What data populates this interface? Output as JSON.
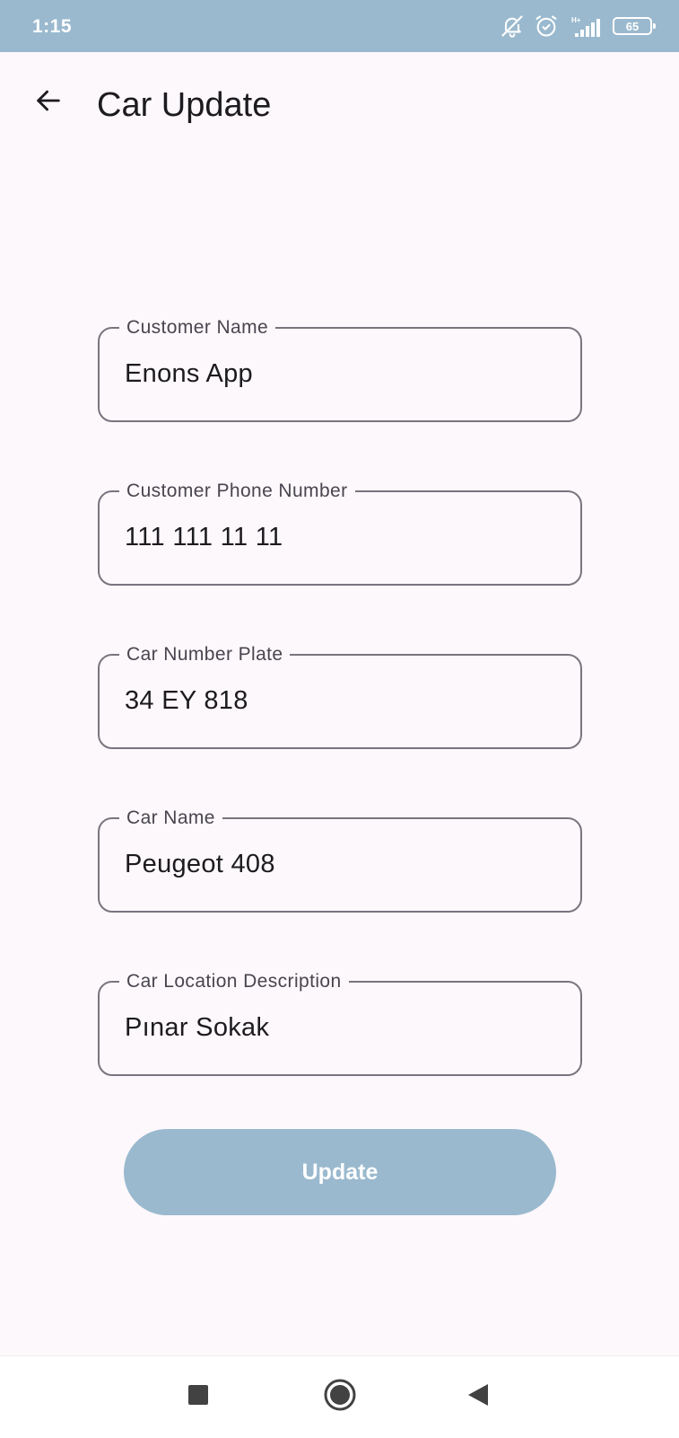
{
  "status_bar": {
    "time": "1:15",
    "battery_level": "65"
  },
  "app_bar": {
    "title": "Car Update"
  },
  "form": {
    "customer_name": {
      "label": "Customer Name",
      "value": "Enons App"
    },
    "customer_phone": {
      "label": "Customer Phone Number",
      "value": "111 111 11 11"
    },
    "car_plate": {
      "label": "Car Number Plate",
      "value": "34 EY 818"
    },
    "car_name": {
      "label": "Car Name",
      "value": "Peugeot 408"
    },
    "car_location": {
      "label": "Car Location Description",
      "value": "Pınar Sokak"
    },
    "submit_label": "Update"
  },
  "icons": {
    "back": "arrow-left-icon",
    "mute": "bell-off-icon",
    "alarm": "alarm-icon",
    "signal": "signal-icon",
    "battery": "battery-icon",
    "nav_recents": "square-icon",
    "nav_home": "circle-icon",
    "nav_back": "triangle-back-icon"
  },
  "colors": {
    "accent": "#9ab9ce",
    "background": "#fdf8fb",
    "outline": "#79747e",
    "text": "#1c1b1f"
  }
}
